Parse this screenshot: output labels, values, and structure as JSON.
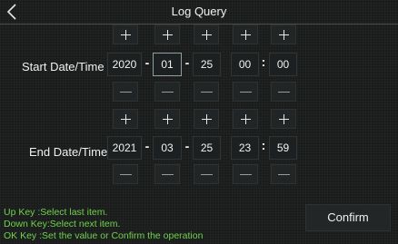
{
  "header": {
    "title": "Log Query",
    "back_icon": "chevron-left-icon"
  },
  "start": {
    "label": "Start Date/Time",
    "year": "2020",
    "month": "01",
    "day": "25",
    "hour": "00",
    "minute": "00"
  },
  "end": {
    "label": "End Date/Time",
    "year": "2021",
    "month": "03",
    "day": "25",
    "hour": "23",
    "minute": "59"
  },
  "separators": {
    "date": "-",
    "time": ":"
  },
  "help": {
    "line1": "Up Key  :Select last item.",
    "line2": "Down Key:Select next item.",
    "line3": "OK Key  :Set the value or Confirm the operation"
  },
  "confirm_label": "Confirm",
  "colors": {
    "help_text": "#6ed24a",
    "background": "#1a1c1c"
  }
}
